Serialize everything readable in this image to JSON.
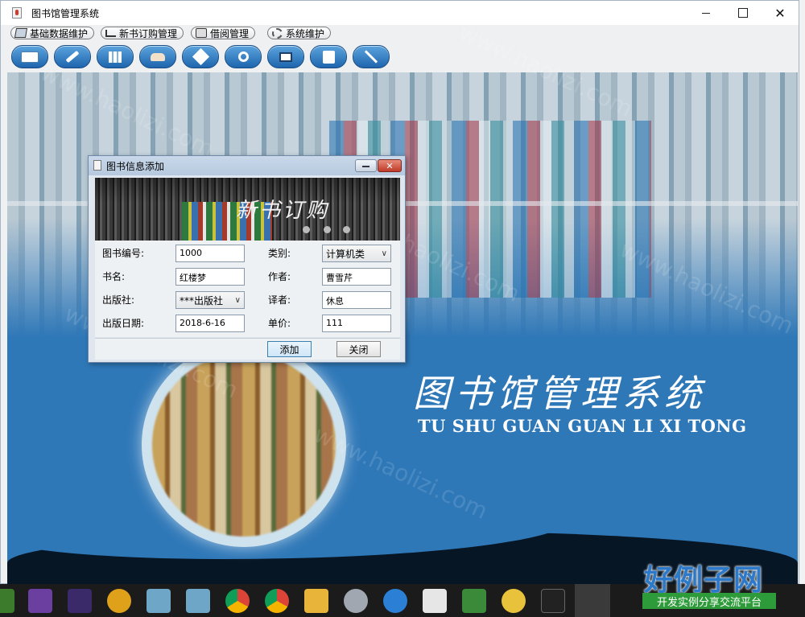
{
  "window": {
    "title": "图书馆管理系统"
  },
  "menubar": {
    "items": [
      {
        "label": "基础数据维护",
        "icon": "cube-icon"
      },
      {
        "label": "新书订购管理",
        "icon": "cart-icon"
      },
      {
        "label": "借阅管理",
        "icon": "lock-icon"
      },
      {
        "label": "系统维护",
        "icon": "gear-icon"
      }
    ]
  },
  "toolbar": {
    "buttons": [
      {
        "icon": "open-book-icon"
      },
      {
        "icon": "pen-icon"
      },
      {
        "icon": "books-icon"
      },
      {
        "icon": "hand-book-icon"
      },
      {
        "icon": "box-icon"
      },
      {
        "icon": "search-icon"
      },
      {
        "icon": "monitor-icon"
      },
      {
        "icon": "form-icon"
      },
      {
        "icon": "tools-icon"
      }
    ]
  },
  "background": {
    "title": "图书馆管理系统",
    "pinyin": "TU SHU GUAN GUAN LI XI TONG",
    "watermark": "www.haolizi.com"
  },
  "dialog": {
    "title": "图书信息添加",
    "banner_title": "新书订购",
    "fields": {
      "book_no": {
        "label": "图书编号:",
        "value": "1000"
      },
      "category": {
        "label": "类别:",
        "value": "计算机类"
      },
      "book_name": {
        "label": "书名:",
        "value": "红楼梦"
      },
      "author": {
        "label": "作者:",
        "value": "曹雪芹"
      },
      "publisher": {
        "label": "出版社:",
        "value": "***出版社"
      },
      "translator": {
        "label": "译者:",
        "value": "休息"
      },
      "pub_date": {
        "label": "出版日期:",
        "value": "2018-6-16"
      },
      "price": {
        "label": "单价:",
        "value": "111"
      }
    },
    "add_label": "添加",
    "close_label": "关闭"
  },
  "brand": {
    "title": "好例子网",
    "subtitle": "开发实例分享交流平台"
  }
}
